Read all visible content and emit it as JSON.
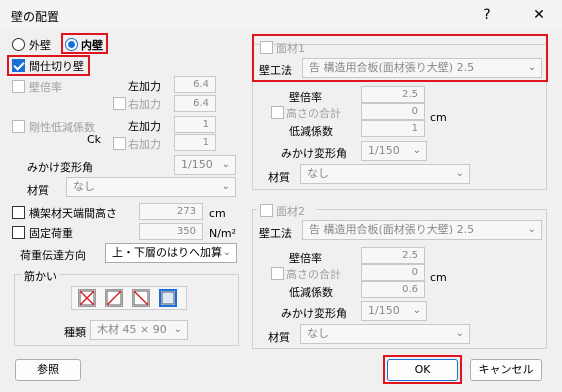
{
  "window": {
    "title": "壁の配置",
    "help_label": "?",
    "close_label": "✕"
  },
  "wall_type": {
    "outer_label": "外壁",
    "inner_label": "内壁",
    "selected": "inner"
  },
  "partition": {
    "label": "間仕切り壁",
    "checked": true
  },
  "ratio": {
    "label": "壁倍率",
    "left_label": "左加力",
    "left_value": "6.4",
    "right_label": "右加力",
    "right_value": "6.4"
  },
  "stiffness": {
    "label": "剛性低減係数",
    "sub_label": "Ck",
    "left_label": "左加力",
    "left_value": "1",
    "right_label": "右加力",
    "right_value": "1"
  },
  "deform": {
    "label": "みかけ変形角",
    "value": "1/150"
  },
  "material": {
    "label": "材質",
    "value": "なし"
  },
  "frame_height": {
    "label": "横架材天端間高さ",
    "value": "273",
    "unit": "cm"
  },
  "fixed_load": {
    "label": "固定荷重",
    "value": "350",
    "unit": "N/m²"
  },
  "load_transfer": {
    "label": "荷重伝達方向",
    "value": "上・下層のはりへ加算"
  },
  "brace": {
    "group_label": "筋かい",
    "type_label": "種類",
    "type_value": "木材 45 × 90"
  },
  "panel1": {
    "title": "面材1",
    "method_label": "壁工法",
    "method_value": "告 構造用合板(面材張り大壁) 2.5",
    "ratio_label": "壁倍率",
    "ratio_value": "2.5",
    "height_total_label": "高さの合計",
    "height_total_value": "0",
    "unit": "cm",
    "reduction_label": "低減係数",
    "reduction_value": "1",
    "deform_label": "みかけ変形角",
    "deform_value": "1/150",
    "material_label": "材質",
    "material_value": "なし"
  },
  "panel2": {
    "title": "面材2",
    "method_label": "壁工法",
    "method_value": "告 構造用合板(面材張り大壁) 2.5",
    "ratio_label": "壁倍率",
    "ratio_value": "2.5",
    "height_total_label": "高さの合計",
    "height_total_value": "0",
    "unit": "cm",
    "reduction_label": "低減係数",
    "reduction_value": "0.6",
    "deform_label": "みかけ変形角",
    "deform_value": "1/150",
    "material_label": "材質",
    "material_value": "なし"
  },
  "buttons": {
    "ref_label": "参照",
    "ok_label": "OK",
    "cancel_label": "キャンセル"
  },
  "colors": {
    "highlight": "#e0141e",
    "accent": "#1a6fd6"
  }
}
